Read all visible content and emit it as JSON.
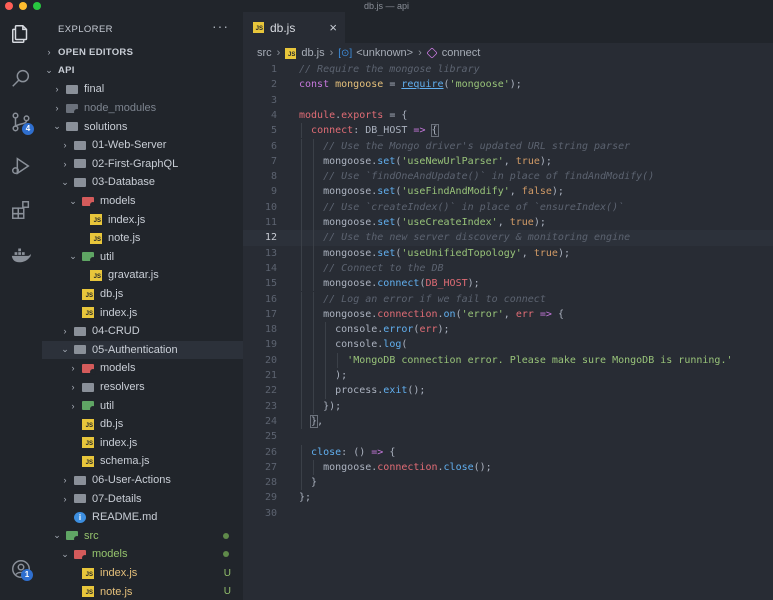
{
  "window": {
    "title": "db.js — api"
  },
  "activity_bar": {
    "icons": [
      "files-icon",
      "search-icon",
      "source-control-icon",
      "run-debug-icon",
      "extensions-icon",
      "docker-icon",
      "account-icon"
    ],
    "scm_badge": "4",
    "account_badge": "1"
  },
  "sidebar": {
    "title": "EXPLORER",
    "more_label": "···",
    "rows": [
      {
        "label": "OPEN EDITORS",
        "kind": "section",
        "chev": "›"
      },
      {
        "label": "API",
        "kind": "section",
        "chev": "⌄"
      },
      {
        "label": "final",
        "kind": "folder",
        "chev": "›",
        "indent": 1
      },
      {
        "label": "node_modules",
        "kind": "folder-dark",
        "chev": "›",
        "indent": 1,
        "style": "dim"
      },
      {
        "label": "solutions",
        "kind": "folder",
        "chev": "⌄",
        "indent": 1
      },
      {
        "label": "01-Web-Server",
        "kind": "folder",
        "chev": "›",
        "indent": 2
      },
      {
        "label": "02-First-GraphQL",
        "kind": "folder",
        "chev": "›",
        "indent": 2
      },
      {
        "label": "03-Database",
        "kind": "folder",
        "chev": "⌄",
        "indent": 2
      },
      {
        "label": "models",
        "kind": "folder-red",
        "chev": "⌄",
        "indent": 3
      },
      {
        "label": "index.js",
        "kind": "js",
        "indent": 4
      },
      {
        "label": "note.js",
        "kind": "js",
        "indent": 4
      },
      {
        "label": "util",
        "kind": "folder-green",
        "chev": "⌄",
        "indent": 3
      },
      {
        "label": "gravatar.js",
        "kind": "js",
        "indent": 4
      },
      {
        "label": "db.js",
        "kind": "js",
        "indent": 3
      },
      {
        "label": "index.js",
        "kind": "js",
        "indent": 3
      },
      {
        "label": "04-CRUD",
        "kind": "folder",
        "chev": "›",
        "indent": 2
      },
      {
        "label": "05-Authentication",
        "kind": "folder",
        "chev": "⌄",
        "indent": 2,
        "active": true
      },
      {
        "label": "models",
        "kind": "folder-red",
        "chev": "›",
        "indent": 3
      },
      {
        "label": "resolvers",
        "kind": "folder",
        "chev": "›",
        "indent": 3
      },
      {
        "label": "util",
        "kind": "folder-green",
        "chev": "›",
        "indent": 3
      },
      {
        "label": "db.js",
        "kind": "js",
        "indent": 3
      },
      {
        "label": "index.js",
        "kind": "js",
        "indent": 3
      },
      {
        "label": "schema.js",
        "kind": "js",
        "indent": 3
      },
      {
        "label": "06-User-Actions",
        "kind": "folder",
        "chev": "›",
        "indent": 2
      },
      {
        "label": "07-Details",
        "kind": "folder",
        "chev": "›",
        "indent": 2
      },
      {
        "label": "README.md",
        "kind": "info",
        "indent": 2
      },
      {
        "label": "src",
        "kind": "folder-green",
        "chev": "⌄",
        "indent": 1,
        "style": "grn",
        "dot": true
      },
      {
        "label": "models",
        "kind": "folder-red",
        "chev": "⌄",
        "indent": 2,
        "style": "grn",
        "dot": true
      },
      {
        "label": "index.js",
        "kind": "js",
        "indent": 3,
        "style": "yel",
        "status": "U"
      },
      {
        "label": "note.js",
        "kind": "js",
        "indent": 3,
        "style": "yel",
        "status": "U"
      }
    ]
  },
  "editor": {
    "tab": {
      "label": "db.js",
      "close": "×"
    },
    "breadcrumb": {
      "folder": "src",
      "file": "db.js",
      "symbol1": "<unknown>",
      "symbol2": "connect",
      "sep": "›"
    },
    "current_line": 12,
    "lines": [
      [
        [
          "c",
          "// Require the mongose library"
        ]
      ],
      [
        [
          "k",
          "const "
        ],
        [
          "v",
          "mongoose"
        ],
        [
          "",
          " = "
        ],
        [
          "fu",
          "require"
        ],
        [
          "",
          "("
        ],
        [
          "s",
          "'mongoose'"
        ],
        [
          "",
          ");"
        ]
      ],
      [],
      [
        [
          "p",
          "module"
        ],
        [
          "",
          "."
        ],
        [
          "p",
          "exports"
        ],
        [
          "",
          " = {"
        ]
      ],
      [
        [
          "",
          "  "
        ],
        [
          "p",
          "connect"
        ],
        [
          "",
          ": "
        ],
        [
          "",
          "DB_HOST "
        ],
        [
          "k",
          "=>"
        ],
        [
          "",
          " "
        ],
        [
          "hl",
          "{"
        ]
      ],
      [
        [
          "",
          "    "
        ],
        [
          "c",
          "// Use the Mongo driver's updated URL string parser"
        ]
      ],
      [
        [
          "",
          "    "
        ],
        [
          "",
          "mongoose."
        ],
        [
          "f",
          "set"
        ],
        [
          "",
          "("
        ],
        [
          "s",
          "'useNewUrlParser'"
        ],
        [
          "",
          ", "
        ],
        [
          "b",
          "true"
        ],
        [
          "",
          ");"
        ]
      ],
      [
        [
          "",
          "    "
        ],
        [
          "c",
          "// Use `findOneAndUpdate()` in place of findAndModify()"
        ]
      ],
      [
        [
          "",
          "    "
        ],
        [
          "",
          "mongoose."
        ],
        [
          "f",
          "set"
        ],
        [
          "",
          "("
        ],
        [
          "s",
          "'useFindAndModify'"
        ],
        [
          "",
          ", "
        ],
        [
          "b",
          "false"
        ],
        [
          "",
          ");"
        ]
      ],
      [
        [
          "",
          "    "
        ],
        [
          "c",
          "// Use `createIndex()` in place of `ensureIndex()`"
        ]
      ],
      [
        [
          "",
          "    "
        ],
        [
          "",
          "mongoose."
        ],
        [
          "f",
          "set"
        ],
        [
          "",
          "("
        ],
        [
          "s",
          "'useCreateIndex'"
        ],
        [
          "",
          ", "
        ],
        [
          "b",
          "true"
        ],
        [
          "",
          ");"
        ]
      ],
      [
        [
          "",
          "    "
        ],
        [
          "c",
          "// Use the new server discovery & monitoring engine"
        ]
      ],
      [
        [
          "",
          "    "
        ],
        [
          "",
          "mongoose."
        ],
        [
          "f",
          "set"
        ],
        [
          "",
          "("
        ],
        [
          "s",
          "'useUnifiedTopology'"
        ],
        [
          "",
          ", "
        ],
        [
          "b",
          "true"
        ],
        [
          "",
          ");"
        ]
      ],
      [
        [
          "",
          "    "
        ],
        [
          "c",
          "// Connect to the DB"
        ]
      ],
      [
        [
          "",
          "    "
        ],
        [
          "",
          "mongoose."
        ],
        [
          "f",
          "connect"
        ],
        [
          "",
          "("
        ],
        [
          "p",
          "DB_HOST"
        ],
        [
          "",
          ");"
        ]
      ],
      [
        [
          "",
          "    "
        ],
        [
          "c",
          "// Log an error if we fail to connect"
        ]
      ],
      [
        [
          "",
          "    "
        ],
        [
          "",
          "mongoose."
        ],
        [
          "p",
          "connection"
        ],
        [
          "",
          "."
        ],
        [
          "f",
          "on"
        ],
        [
          "",
          "("
        ],
        [
          "s",
          "'error'"
        ],
        [
          "",
          ", "
        ],
        [
          "p",
          "err"
        ],
        [
          "",
          " "
        ],
        [
          "k",
          "=>"
        ],
        [
          "",
          " {"
        ]
      ],
      [
        [
          "",
          "      "
        ],
        [
          "",
          "console."
        ],
        [
          "f",
          "error"
        ],
        [
          "",
          "("
        ],
        [
          "p",
          "err"
        ],
        [
          "",
          ");"
        ]
      ],
      [
        [
          "",
          "      "
        ],
        [
          "",
          "console."
        ],
        [
          "f",
          "log"
        ],
        [
          "",
          "("
        ]
      ],
      [
        [
          "",
          "        "
        ],
        [
          "s",
          "'MongoDB connection error. Please make sure MongoDB is running.'"
        ]
      ],
      [
        [
          "",
          "      "
        ],
        [
          "",
          ");"
        ]
      ],
      [
        [
          "",
          "      "
        ],
        [
          "",
          "process."
        ],
        [
          "f",
          "exit"
        ],
        [
          "",
          "();"
        ]
      ],
      [
        [
          "",
          "    "
        ],
        [
          "",
          "});"
        ]
      ],
      [
        [
          "",
          "  "
        ],
        [
          "hl",
          "}"
        ],
        [
          "",
          ","
        ]
      ],
      [],
      [
        [
          "",
          "  "
        ],
        [
          "f",
          "close"
        ],
        [
          "",
          ": () "
        ],
        [
          "k",
          "=>"
        ],
        [
          "",
          " {"
        ]
      ],
      [
        [
          "",
          "    "
        ],
        [
          "",
          "mongoose."
        ],
        [
          "p",
          "connection"
        ],
        [
          "",
          "."
        ],
        [
          "f",
          "close"
        ],
        [
          "",
          "();"
        ]
      ],
      [
        [
          "",
          "  "
        ],
        [
          "",
          "}"
        ]
      ],
      [
        [
          "",
          "};"
        ]
      ],
      []
    ]
  }
}
